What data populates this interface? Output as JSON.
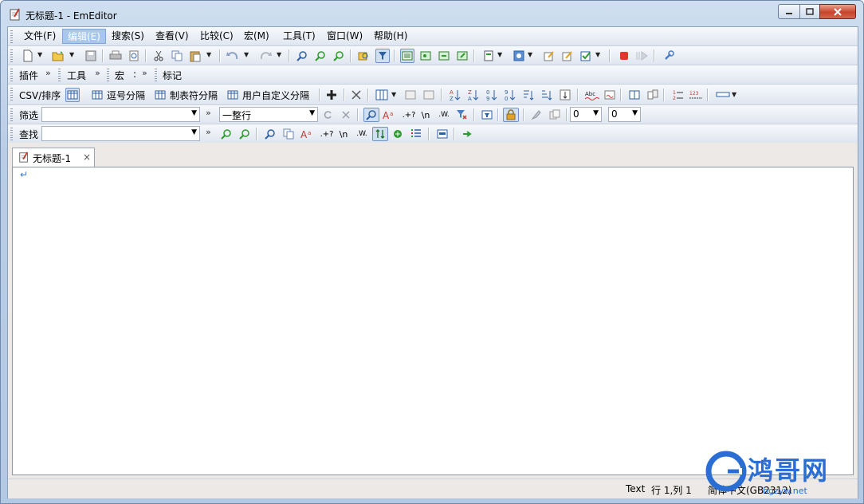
{
  "window": {
    "title": "无标题-1 - EmEditor"
  },
  "menu": [
    "文件(F)",
    "编辑(E)",
    "搜索(S)",
    "查看(V)",
    "比较(C)",
    "宏(M)",
    "工具(T)",
    "窗口(W)",
    "帮助(H)"
  ],
  "menu_active_index": 1,
  "toolbar_groups": {
    "plugins": "插件",
    "tools": "工具",
    "macro": "宏",
    "macro_sep": ":",
    "marks": "标记"
  },
  "csv_bar": {
    "label": "CSV/排序",
    "comma": "逗号分隔",
    "tab": "制表符分隔",
    "user": "用户自定义分隔",
    "sort_az": "A↓Z",
    "abc": "Abc"
  },
  "filter_bar": {
    "label": "筛选",
    "input_value": "",
    "mode_value": "一整行",
    "num1": "0",
    "num2": "0",
    "regex": ".+?",
    "newline": "\\n",
    "word": ".W."
  },
  "find_bar": {
    "label": "查找",
    "input_value": "",
    "regex": ".+?",
    "newline": "\\n",
    "word": ".W."
  },
  "tab": {
    "label": "无标题-1",
    "close": "×"
  },
  "editor": {
    "eol_mark": "↵"
  },
  "status": {
    "mode": "Text",
    "position": "行 1,列 1",
    "encoding": "简体中文(GB2312)"
  },
  "watermark": {
    "text": "鸿哥网",
    "url": "hgzyw.net"
  },
  "colors": {
    "accent": "#2a6ed3",
    "active_menu": "#a9c7ea"
  }
}
